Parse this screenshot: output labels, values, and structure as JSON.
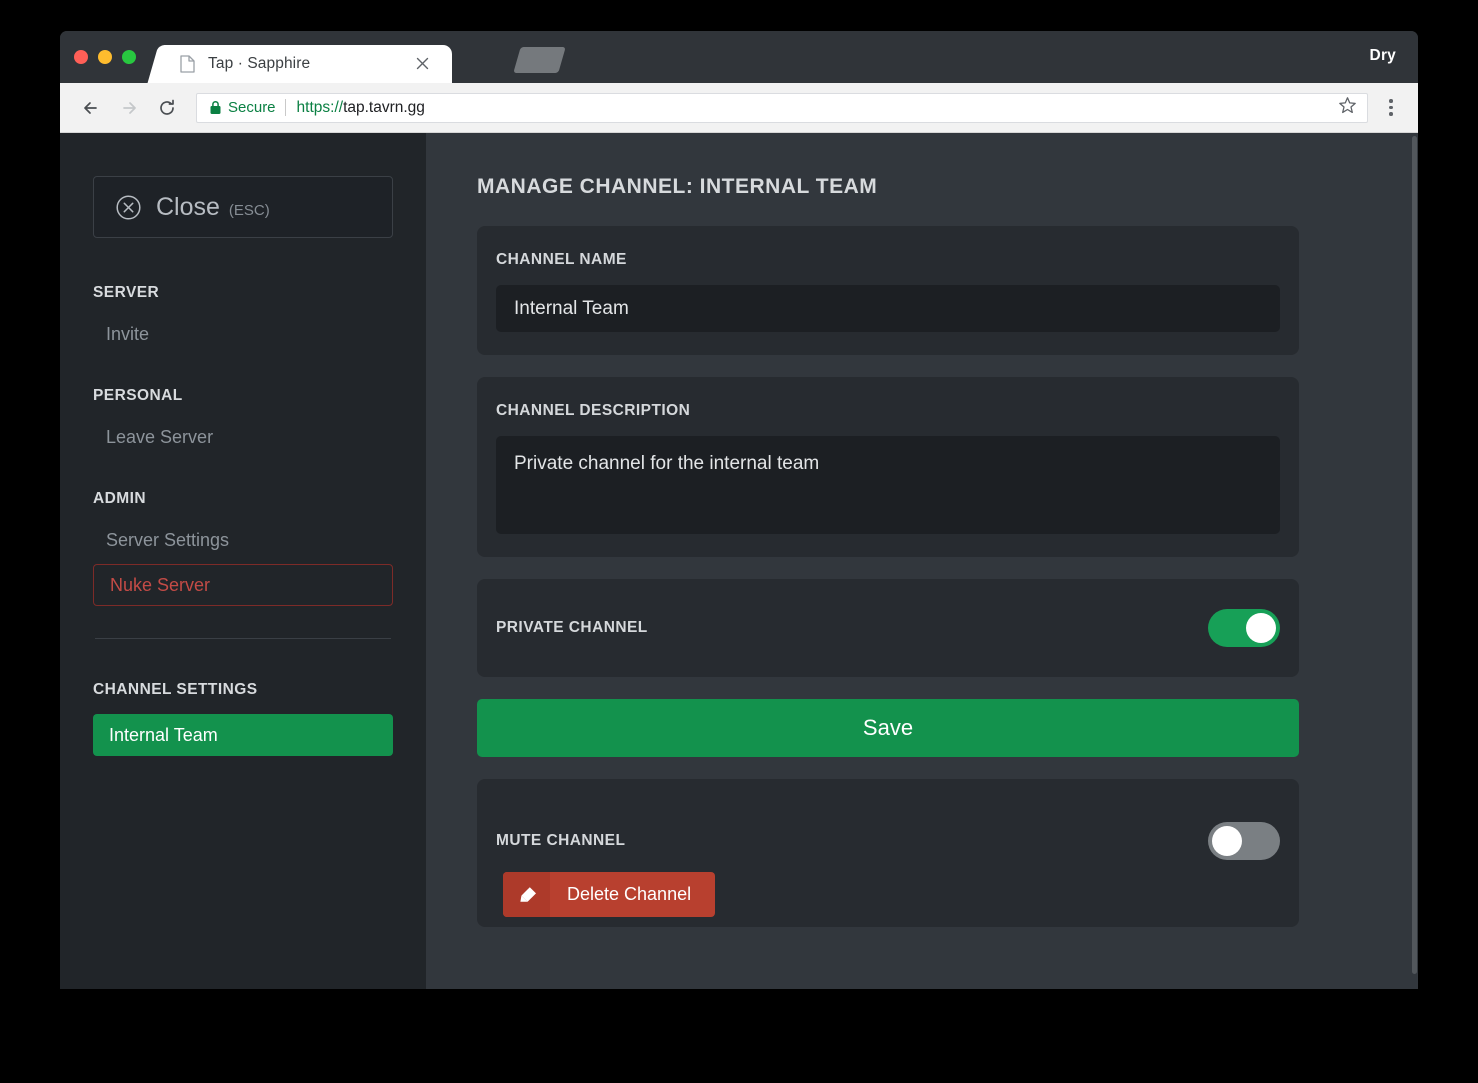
{
  "browser": {
    "tab": {
      "title": "Tap · Sapphire",
      "favicon_icon": "document-icon",
      "close_icon": "close-icon"
    },
    "new_tab_icon": "new-tab-icon",
    "window_user_label": "Dry",
    "toolbar": {
      "back_icon": "arrow-left-icon",
      "forward_icon": "arrow-right-icon",
      "reload_icon": "reload-icon",
      "lock_icon": "lock-icon",
      "secure_label": "Secure",
      "url_scheme": "https://",
      "url_host": "tap.tavrn.gg",
      "bookmark_icon": "star-icon",
      "menu_icon": "kebab-menu-icon"
    }
  },
  "sidebar": {
    "close": {
      "icon": "close-circle-icon",
      "label": "Close",
      "shortcut": "(ESC)"
    },
    "sections": [
      {
        "heading": "SERVER",
        "items": [
          {
            "label": "Invite"
          }
        ]
      },
      {
        "heading": "PERSONAL",
        "items": [
          {
            "label": "Leave Server"
          }
        ]
      },
      {
        "heading": "ADMIN",
        "items": [
          {
            "label": "Server Settings"
          },
          {
            "label": "Nuke Server"
          }
        ]
      },
      {
        "heading": "CHANNEL SETTINGS",
        "items": [
          {
            "label": "Internal Team"
          }
        ]
      }
    ],
    "server_heading": "SERVER",
    "invite_label": "Invite",
    "personal_heading": "PERSONAL",
    "leave_server_label": "Leave Server",
    "admin_heading": "ADMIN",
    "server_settings_label": "Server Settings",
    "nuke_server_label": "Nuke Server",
    "channel_settings_heading": "CHANNEL SETTINGS",
    "active_channel_label": "Internal Team"
  },
  "main": {
    "page_title": "MANAGE CHANNEL: INTERNAL TEAM",
    "channel_name": {
      "label": "CHANNEL NAME",
      "value": "Internal Team"
    },
    "channel_description": {
      "label": "CHANNEL DESCRIPTION",
      "value": "Private channel for the internal team"
    },
    "private_channel": {
      "label": "PRIVATE CHANNEL",
      "state": "on"
    },
    "save_label": "Save",
    "mute_channel": {
      "label": "MUTE CHANNEL",
      "state": "off"
    },
    "delete_channel": {
      "icon": "eraser-icon",
      "label": "Delete Channel"
    }
  },
  "colors": {
    "accent_green": "#13924d",
    "toggle_on": "#17a057",
    "toggle_off": "#7a7f83",
    "danger_red": "#c34b46",
    "delete_red": "#b8402f",
    "sidebar_bg": "#212529",
    "main_bg": "#32373d",
    "card_bg": "#272b30",
    "input_bg": "#1c1f23"
  }
}
